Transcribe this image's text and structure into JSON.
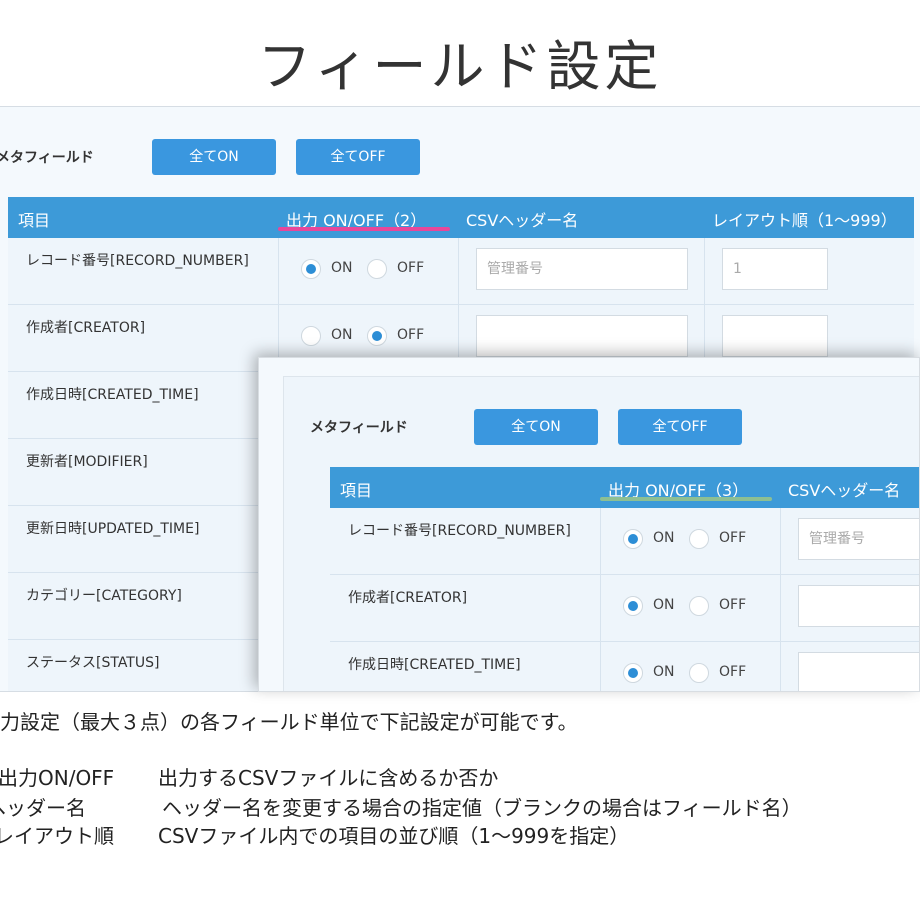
{
  "title": "フィールド設定",
  "back": {
    "section_label": "メタフィールド",
    "btn_all_on": "全てON",
    "btn_all_off": "全てOFF",
    "header": {
      "item": "項目",
      "output": "出力 ON/OFF（2）",
      "csv_header": "CSVヘッダー名",
      "layout": "レイアウト順（1～999）"
    },
    "rows": [
      {
        "name": "レコード番号[RECORD_NUMBER]",
        "on": "ON",
        "off": "OFF",
        "csv": "管理番号",
        "order": "1"
      },
      {
        "name": "作成者[CREATOR]",
        "on": "ON",
        "off": "OFF",
        "csv": "",
        "order": ""
      },
      {
        "name": "作成日時[CREATED_TIME]"
      },
      {
        "name": "更新者[MODIFIER]"
      },
      {
        "name": "更新日時[UPDATED_TIME]"
      },
      {
        "name": "カテゴリー[CATEGORY]"
      },
      {
        "name": "ステータス[STATUS]"
      }
    ]
  },
  "front": {
    "section_label": "メタフィールド",
    "btn_all_on": "全てON",
    "btn_all_off": "全てOFF",
    "header": {
      "item": "項目",
      "output": "出力 ON/OFF（3）",
      "csv_header": "CSVヘッダー名"
    },
    "rows": [
      {
        "name": "レコード番号[RECORD_NUMBER]",
        "on": "ON",
        "off": "OFF",
        "csv": "管理番号"
      },
      {
        "name": "作成者[CREATOR]",
        "on": "ON",
        "off": "OFF",
        "csv": ""
      },
      {
        "name": "作成日時[CREATED_TIME]",
        "on": "ON",
        "off": "OFF",
        "csv": ""
      }
    ]
  },
  "description": {
    "intro": "力設定（最大３点）の各フィールド単位で下記設定が可能です。",
    "items": [
      {
        "term": "出力ON/OFF",
        "text": "出力するCSVファイルに含めるか否か"
      },
      {
        "term": "ヘッダー名",
        "text": "ヘッダー名を変更する場合の指定値（ブランクの場合はフィールド名）"
      },
      {
        "term": "レイアウト順",
        "text": "CSVファイル内での項目の並び順（1～999を指定）"
      }
    ]
  },
  "colors": {
    "accent": "#3a97df",
    "highlight_pink": "#e8479a",
    "highlight_green": "#8dbf93"
  }
}
